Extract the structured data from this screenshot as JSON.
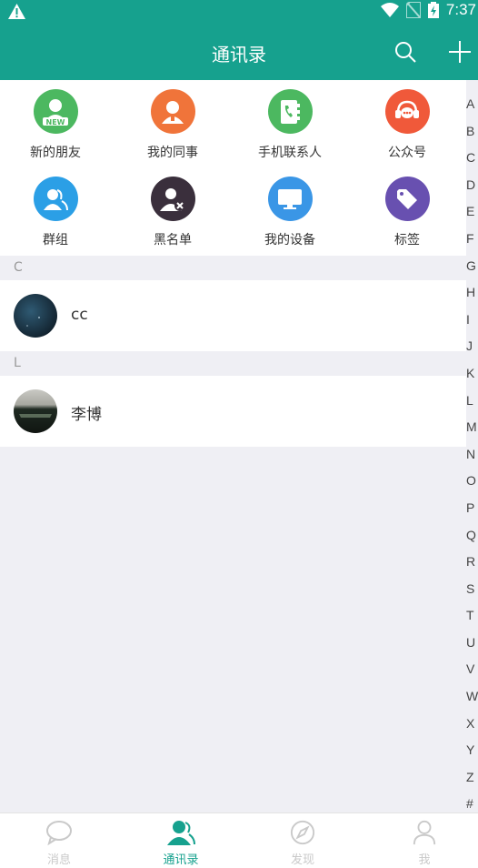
{
  "status": {
    "time": "7:37"
  },
  "header": {
    "title": "通讯录"
  },
  "functions": [
    {
      "label": "新的朋友",
      "color": "#4cb860",
      "icon": "new-friend-icon"
    },
    {
      "label": "我的同事",
      "color": "#f0743a",
      "icon": "colleague-icon"
    },
    {
      "label": "手机联系人",
      "color": "#4cb860",
      "icon": "phone-contacts-icon"
    },
    {
      "label": "公众号",
      "color": "#f0593a",
      "icon": "public-account-icon"
    },
    {
      "label": "群组",
      "color": "#2b9fe6",
      "icon": "group-icon"
    },
    {
      "label": "黑名单",
      "color": "#3a2f3c",
      "icon": "blacklist-icon"
    },
    {
      "label": "我的设备",
      "color": "#3a96e6",
      "icon": "device-icon"
    },
    {
      "label": "标签",
      "color": "#6850b0",
      "icon": "tag-icon"
    }
  ],
  "sections": [
    {
      "letter": "C",
      "contacts": [
        {
          "name": "cc"
        }
      ]
    },
    {
      "letter": "L",
      "contacts": [
        {
          "name": "李博"
        }
      ]
    }
  ],
  "index": [
    "A",
    "B",
    "C",
    "D",
    "E",
    "F",
    "G",
    "H",
    "I",
    "J",
    "K",
    "L",
    "M",
    "N",
    "O",
    "P",
    "Q",
    "R",
    "S",
    "T",
    "U",
    "V",
    "W",
    "X",
    "Y",
    "Z",
    "#"
  ],
  "tabs": [
    {
      "label": "消息",
      "active": false
    },
    {
      "label": "通讯录",
      "active": true
    },
    {
      "label": "发现",
      "active": false
    },
    {
      "label": "我",
      "active": false
    }
  ],
  "colors": {
    "accent": "#16a18e",
    "inactive_tab": "#c9c9c9"
  }
}
